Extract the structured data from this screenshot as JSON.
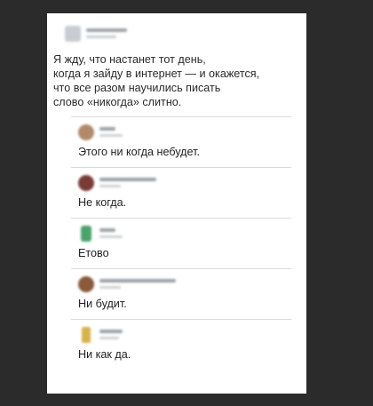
{
  "post": {
    "text_lines": [
      "Я жду, что настанет тот день,",
      "когда я зайду в интернет — и окажется,",
      "что все разом научились писать",
      "слово «никогда» слитно."
    ]
  },
  "comments": [
    {
      "text": "Этого ни когда небудет.",
      "avatar_color": "#b08a6a"
    },
    {
      "text": "Не когда.",
      "avatar_color": "#7a3b36"
    },
    {
      "text": "Етово",
      "avatar_color": "#4aa36b"
    },
    {
      "text": "Ни будит.",
      "avatar_color": "#8a5a3a"
    },
    {
      "text": "Ни как да.",
      "avatar_color": "#d8b24a"
    }
  ],
  "colors": {
    "page_background": "#2b2b2b",
    "card_background": "#ffffff",
    "text": "#222222"
  }
}
